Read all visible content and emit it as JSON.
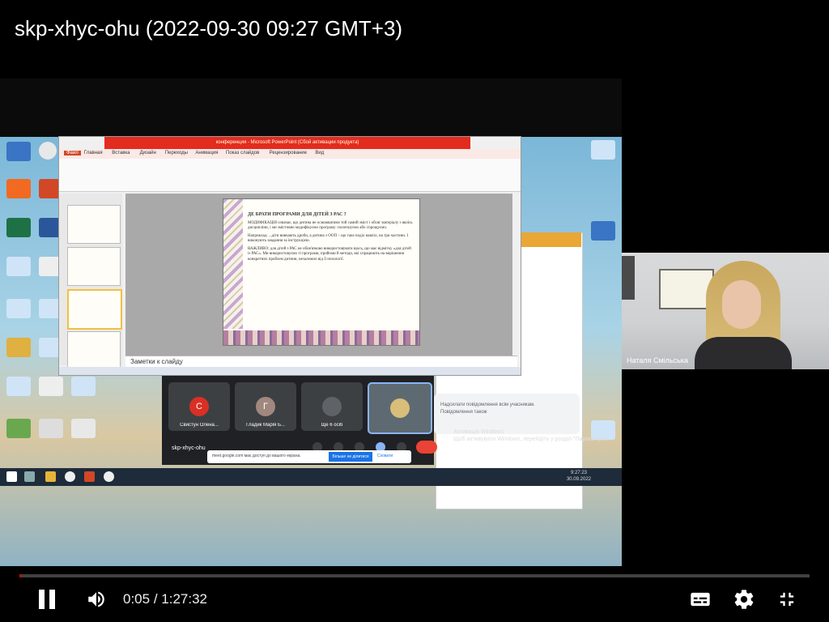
{
  "video": {
    "title": "skp-xhyc-ohu (2022-09-30 09:27 GMT+3)",
    "current_time": "0:05",
    "separator": "/",
    "duration": "1:27:32",
    "progress_fraction": 0.0009
  },
  "ppt": {
    "title": "конференция - Microsoft PowerPoint (Сбой активации продукта)",
    "menu": [
      "Файл",
      "Главная",
      "Вставка",
      "Дизайн",
      "Переходы",
      "Анимация",
      "Показ слайдов",
      "Рецензирование",
      "Вид"
    ],
    "notes_placeholder": "Заметки к слайду",
    "slide": {
      "heading": "ДЕ БРАТИ ПРОГРАМИ ДЛЯ ДІТЕЙ З РАС ?",
      "p1": "МОДИФІКАЦІЯ означає, що дитина не освоюватиме той самий зміст і обсяг матеріалу з якоїсь дисципліни, і ми змістовно модифікуємо програму: полегшуємо або спрощуємо.",
      "p2": "Наприклад: ...діти вивчають дроби, а дитина з ООП – що таке поділ навпіл, на три частини. І виконують завдання за інструкцією.",
      "p3": "ВАЖЛИВО: для дітей з РАС не обов'язково використовувати щось, що має відмітку «для дітей із РАС». Ми використовуємо ті програми, прийоми й методи, які спрацюють на вирішення конкретних проблем дитини, незалежно від її нозології."
    }
  },
  "meet": {
    "participants": [
      {
        "initial": "С",
        "name": "Свистун Олена...",
        "color": "#d93025"
      },
      {
        "initial": "Г",
        "name": "Гладик Марія Б...",
        "color": "#a1887f"
      },
      {
        "initial": "",
        "name": "Ще 6 осіб",
        "color": "#3c4043"
      }
    ],
    "meeting_code": "skp-xhyc-ohu",
    "chat_placeholder": "Надсилати повідомлення всім учасникам. Повідомлення також",
    "share_message": "meet.google.com має доступ до вашого екрана.",
    "share_stop": "Більше не ділитися",
    "share_hide": "Сховати",
    "windows_activation": "Активація Windows",
    "windows_activation_sub": "Щоб активувати Windows, перейдіть у розділ \"Параметри\"."
  },
  "webcam": {
    "name": "Наталя Смільська"
  },
  "taskbar": {
    "time": "9:27:23",
    "date": "30.09.2022",
    "lang": "УКР"
  },
  "colors": {
    "progress": "#ff0000",
    "end_call": "#ea4335",
    "ppt_title": "#e32b1e"
  },
  "icons": [
    "pause-icon",
    "volume-icon",
    "subtitles-icon",
    "settings-icon",
    "exit-fullscreen-icon"
  ]
}
